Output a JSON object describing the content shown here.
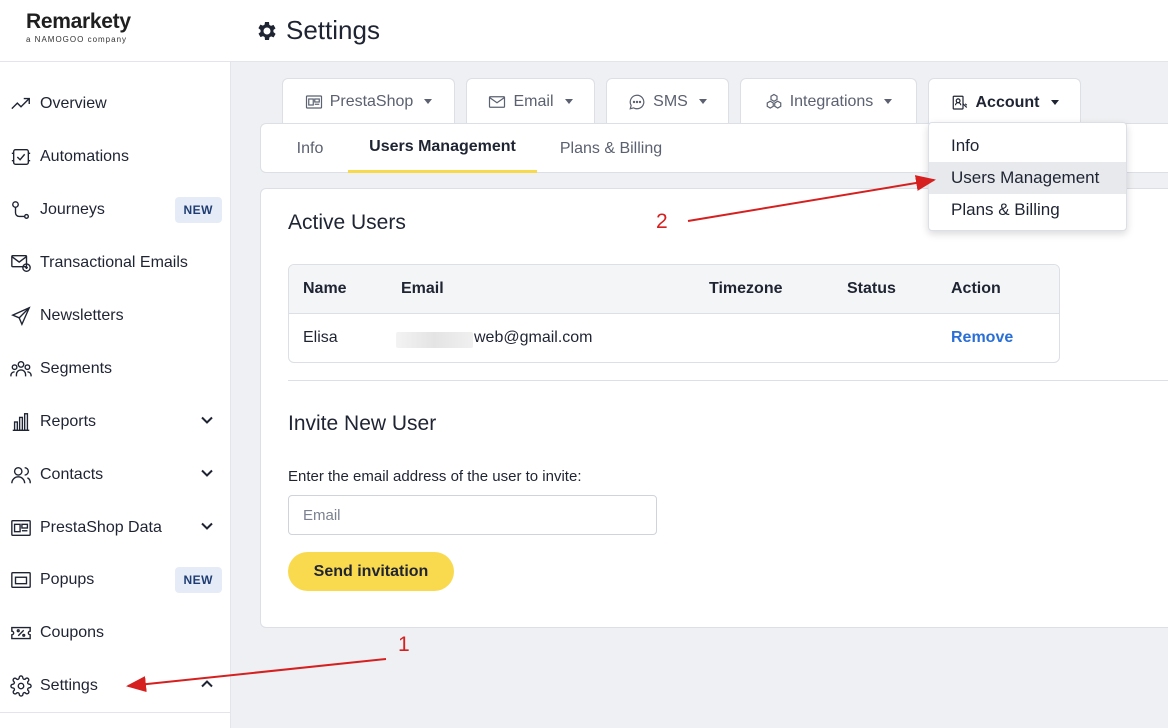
{
  "app": {
    "brand": "Remarkety",
    "brand_sub": "a NAMOGOO company",
    "page_title": "Settings"
  },
  "sidebar": {
    "items": [
      {
        "label": "Overview",
        "icon": "trend-icon"
      },
      {
        "label": "Automations",
        "icon": "automation-icon"
      },
      {
        "label": "Journeys",
        "icon": "journey-icon",
        "badge": "NEW"
      },
      {
        "label": "Transactional Emails",
        "icon": "transactional-email-icon"
      },
      {
        "label": "Newsletters",
        "icon": "paper-plane-icon"
      },
      {
        "label": "Segments",
        "icon": "segments-icon"
      },
      {
        "label": "Reports",
        "icon": "reports-icon",
        "expandable": "down"
      },
      {
        "label": "Contacts",
        "icon": "contacts-icon",
        "expandable": "down"
      },
      {
        "label": "PrestaShop Data",
        "icon": "store-data-icon",
        "expandable": "down"
      },
      {
        "label": "Popups",
        "icon": "popup-icon",
        "badge": "NEW"
      },
      {
        "label": "Coupons",
        "icon": "coupon-icon"
      },
      {
        "label": "Settings",
        "icon": "gear-icon",
        "expandable": "up"
      }
    ]
  },
  "top_tabs": [
    {
      "label": "PrestaShop",
      "icon": "store-icon"
    },
    {
      "label": "Email",
      "icon": "envelope-icon"
    },
    {
      "label": "SMS",
      "icon": "chat-bubble-icon"
    },
    {
      "label": "Integrations",
      "icon": "cubes-icon"
    },
    {
      "label": "Account",
      "icon": "account-icon",
      "active": true
    }
  ],
  "sub_tabs": [
    {
      "label": "Info"
    },
    {
      "label": "Users Management",
      "active": true
    },
    {
      "label": "Plans & Billing"
    }
  ],
  "active_users": {
    "title": "Active Users",
    "columns": [
      "Name",
      "Email",
      "Timezone",
      "Status",
      "Action"
    ],
    "rows": [
      {
        "name": "Elisa",
        "email": "web@gmail.com",
        "timezone": "",
        "status": "",
        "action": "Remove"
      }
    ]
  },
  "invite": {
    "title": "Invite New User",
    "label": "Enter the email address of the user to invite:",
    "placeholder": "Email",
    "button": "Send invitation"
  },
  "account_dropdown": {
    "items": [
      "Info",
      "Users Management",
      "Plans & Billing"
    ],
    "highlighted": "Users Management"
  },
  "annotations": {
    "step1": "1",
    "step2": "2",
    "color": "#d61f1f"
  },
  "colors": {
    "accent_yellow": "#f9d94e",
    "link_blue": "#2a6fd6",
    "badge_bg": "#e6ecf7"
  }
}
